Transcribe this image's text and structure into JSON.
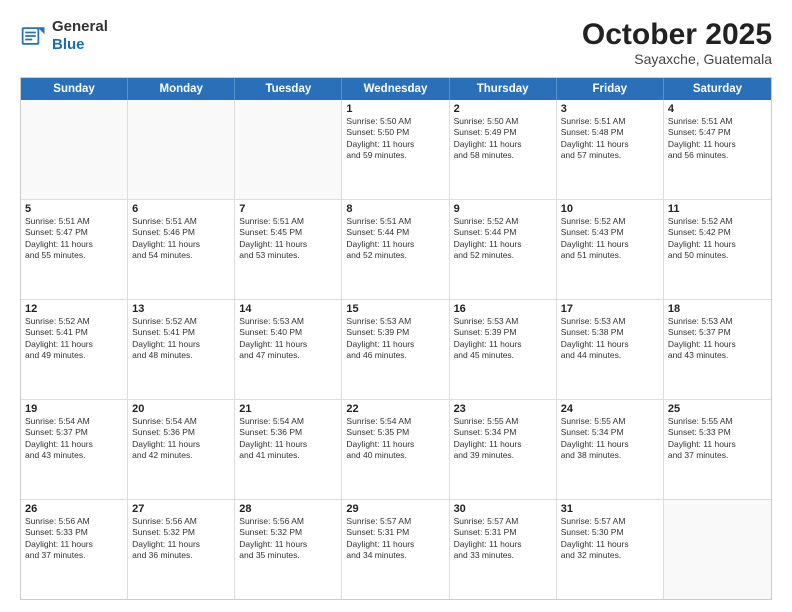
{
  "header": {
    "logo_line1": "General",
    "logo_line2": "Blue",
    "month": "October 2025",
    "location": "Sayaxche, Guatemala"
  },
  "weekdays": [
    "Sunday",
    "Monday",
    "Tuesday",
    "Wednesday",
    "Thursday",
    "Friday",
    "Saturday"
  ],
  "rows": [
    [
      {
        "day": "",
        "text": ""
      },
      {
        "day": "",
        "text": ""
      },
      {
        "day": "",
        "text": ""
      },
      {
        "day": "1",
        "text": "Sunrise: 5:50 AM\nSunset: 5:50 PM\nDaylight: 11 hours\nand 59 minutes."
      },
      {
        "day": "2",
        "text": "Sunrise: 5:50 AM\nSunset: 5:49 PM\nDaylight: 11 hours\nand 58 minutes."
      },
      {
        "day": "3",
        "text": "Sunrise: 5:51 AM\nSunset: 5:48 PM\nDaylight: 11 hours\nand 57 minutes."
      },
      {
        "day": "4",
        "text": "Sunrise: 5:51 AM\nSunset: 5:47 PM\nDaylight: 11 hours\nand 56 minutes."
      }
    ],
    [
      {
        "day": "5",
        "text": "Sunrise: 5:51 AM\nSunset: 5:47 PM\nDaylight: 11 hours\nand 55 minutes."
      },
      {
        "day": "6",
        "text": "Sunrise: 5:51 AM\nSunset: 5:46 PM\nDaylight: 11 hours\nand 54 minutes."
      },
      {
        "day": "7",
        "text": "Sunrise: 5:51 AM\nSunset: 5:45 PM\nDaylight: 11 hours\nand 53 minutes."
      },
      {
        "day": "8",
        "text": "Sunrise: 5:51 AM\nSunset: 5:44 PM\nDaylight: 11 hours\nand 52 minutes."
      },
      {
        "day": "9",
        "text": "Sunrise: 5:52 AM\nSunset: 5:44 PM\nDaylight: 11 hours\nand 52 minutes."
      },
      {
        "day": "10",
        "text": "Sunrise: 5:52 AM\nSunset: 5:43 PM\nDaylight: 11 hours\nand 51 minutes."
      },
      {
        "day": "11",
        "text": "Sunrise: 5:52 AM\nSunset: 5:42 PM\nDaylight: 11 hours\nand 50 minutes."
      }
    ],
    [
      {
        "day": "12",
        "text": "Sunrise: 5:52 AM\nSunset: 5:41 PM\nDaylight: 11 hours\nand 49 minutes."
      },
      {
        "day": "13",
        "text": "Sunrise: 5:52 AM\nSunset: 5:41 PM\nDaylight: 11 hours\nand 48 minutes."
      },
      {
        "day": "14",
        "text": "Sunrise: 5:53 AM\nSunset: 5:40 PM\nDaylight: 11 hours\nand 47 minutes."
      },
      {
        "day": "15",
        "text": "Sunrise: 5:53 AM\nSunset: 5:39 PM\nDaylight: 11 hours\nand 46 minutes."
      },
      {
        "day": "16",
        "text": "Sunrise: 5:53 AM\nSunset: 5:39 PM\nDaylight: 11 hours\nand 45 minutes."
      },
      {
        "day": "17",
        "text": "Sunrise: 5:53 AM\nSunset: 5:38 PM\nDaylight: 11 hours\nand 44 minutes."
      },
      {
        "day": "18",
        "text": "Sunrise: 5:53 AM\nSunset: 5:37 PM\nDaylight: 11 hours\nand 43 minutes."
      }
    ],
    [
      {
        "day": "19",
        "text": "Sunrise: 5:54 AM\nSunset: 5:37 PM\nDaylight: 11 hours\nand 43 minutes."
      },
      {
        "day": "20",
        "text": "Sunrise: 5:54 AM\nSunset: 5:36 PM\nDaylight: 11 hours\nand 42 minutes."
      },
      {
        "day": "21",
        "text": "Sunrise: 5:54 AM\nSunset: 5:36 PM\nDaylight: 11 hours\nand 41 minutes."
      },
      {
        "day": "22",
        "text": "Sunrise: 5:54 AM\nSunset: 5:35 PM\nDaylight: 11 hours\nand 40 minutes."
      },
      {
        "day": "23",
        "text": "Sunrise: 5:55 AM\nSunset: 5:34 PM\nDaylight: 11 hours\nand 39 minutes."
      },
      {
        "day": "24",
        "text": "Sunrise: 5:55 AM\nSunset: 5:34 PM\nDaylight: 11 hours\nand 38 minutes."
      },
      {
        "day": "25",
        "text": "Sunrise: 5:55 AM\nSunset: 5:33 PM\nDaylight: 11 hours\nand 37 minutes."
      }
    ],
    [
      {
        "day": "26",
        "text": "Sunrise: 5:56 AM\nSunset: 5:33 PM\nDaylight: 11 hours\nand 37 minutes."
      },
      {
        "day": "27",
        "text": "Sunrise: 5:56 AM\nSunset: 5:32 PM\nDaylight: 11 hours\nand 36 minutes."
      },
      {
        "day": "28",
        "text": "Sunrise: 5:56 AM\nSunset: 5:32 PM\nDaylight: 11 hours\nand 35 minutes."
      },
      {
        "day": "29",
        "text": "Sunrise: 5:57 AM\nSunset: 5:31 PM\nDaylight: 11 hours\nand 34 minutes."
      },
      {
        "day": "30",
        "text": "Sunrise: 5:57 AM\nSunset: 5:31 PM\nDaylight: 11 hours\nand 33 minutes."
      },
      {
        "day": "31",
        "text": "Sunrise: 5:57 AM\nSunset: 5:30 PM\nDaylight: 11 hours\nand 32 minutes."
      },
      {
        "day": "",
        "text": ""
      }
    ]
  ]
}
